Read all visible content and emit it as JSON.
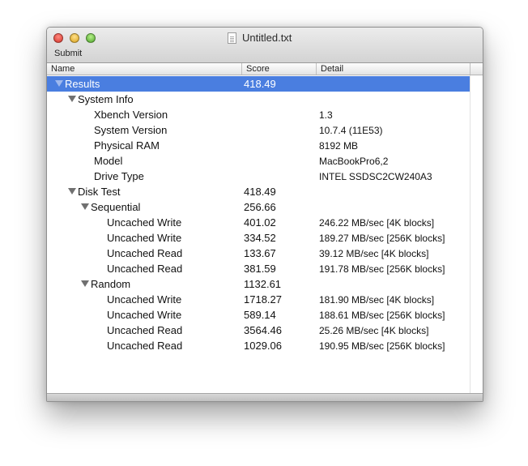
{
  "window": {
    "title": "Untitled.txt"
  },
  "toolbar": {
    "submit_label": "Submit"
  },
  "columns": {
    "name": "Name",
    "score": "Score",
    "detail": "Detail"
  },
  "rows": [
    {
      "name": "Results",
      "score": "418.49",
      "detail": "",
      "level": 0,
      "expandable": true,
      "selected": true
    },
    {
      "name": "System Info",
      "score": "",
      "detail": "",
      "level": 1,
      "expandable": true
    },
    {
      "name": "Xbench Version",
      "score": "",
      "detail": "1.3",
      "level": 2,
      "expandable": false
    },
    {
      "name": "System Version",
      "score": "",
      "detail": "10.7.4 (11E53)",
      "level": 2,
      "expandable": false
    },
    {
      "name": "Physical RAM",
      "score": "",
      "detail": "8192 MB",
      "level": 2,
      "expandable": false
    },
    {
      "name": "Model",
      "score": "",
      "detail": "MacBookPro6,2",
      "level": 2,
      "expandable": false
    },
    {
      "name": "Drive Type",
      "score": "",
      "detail": "INTEL SSDSC2CW240A3",
      "level": 2,
      "expandable": false
    },
    {
      "name": "Disk Test",
      "score": "418.49",
      "detail": "",
      "level": 1,
      "expandable": true
    },
    {
      "name": "Sequential",
      "score": "256.66",
      "detail": "",
      "level": 2,
      "expandable": true
    },
    {
      "name": "Uncached Write",
      "score": "401.02",
      "detail": "246.22 MB/sec [4K blocks]",
      "level": 3,
      "expandable": false
    },
    {
      "name": "Uncached Write",
      "score": "334.52",
      "detail": "189.27 MB/sec [256K blocks]",
      "level": 3,
      "expandable": false
    },
    {
      "name": "Uncached Read",
      "score": "133.67",
      "detail": "39.12 MB/sec [4K blocks]",
      "level": 3,
      "expandable": false
    },
    {
      "name": "Uncached Read",
      "score": "381.59",
      "detail": "191.78 MB/sec [256K blocks]",
      "level": 3,
      "expandable": false
    },
    {
      "name": "Random",
      "score": "1132.61",
      "detail": "",
      "level": 2,
      "expandable": true
    },
    {
      "name": "Uncached Write",
      "score": "1718.27",
      "detail": "181.90 MB/sec [4K blocks]",
      "level": 3,
      "expandable": false
    },
    {
      "name": "Uncached Write",
      "score": "589.14",
      "detail": "188.61 MB/sec [256K blocks]",
      "level": 3,
      "expandable": false
    },
    {
      "name": "Uncached Read",
      "score": "3564.46",
      "detail": "25.26 MB/sec [4K blocks]",
      "level": 3,
      "expandable": false
    },
    {
      "name": "Uncached Read",
      "score": "1029.06",
      "detail": "190.95 MB/sec [256K blocks]",
      "level": 3,
      "expandable": false
    }
  ],
  "colors": {
    "selection": "#4a7ee0"
  }
}
